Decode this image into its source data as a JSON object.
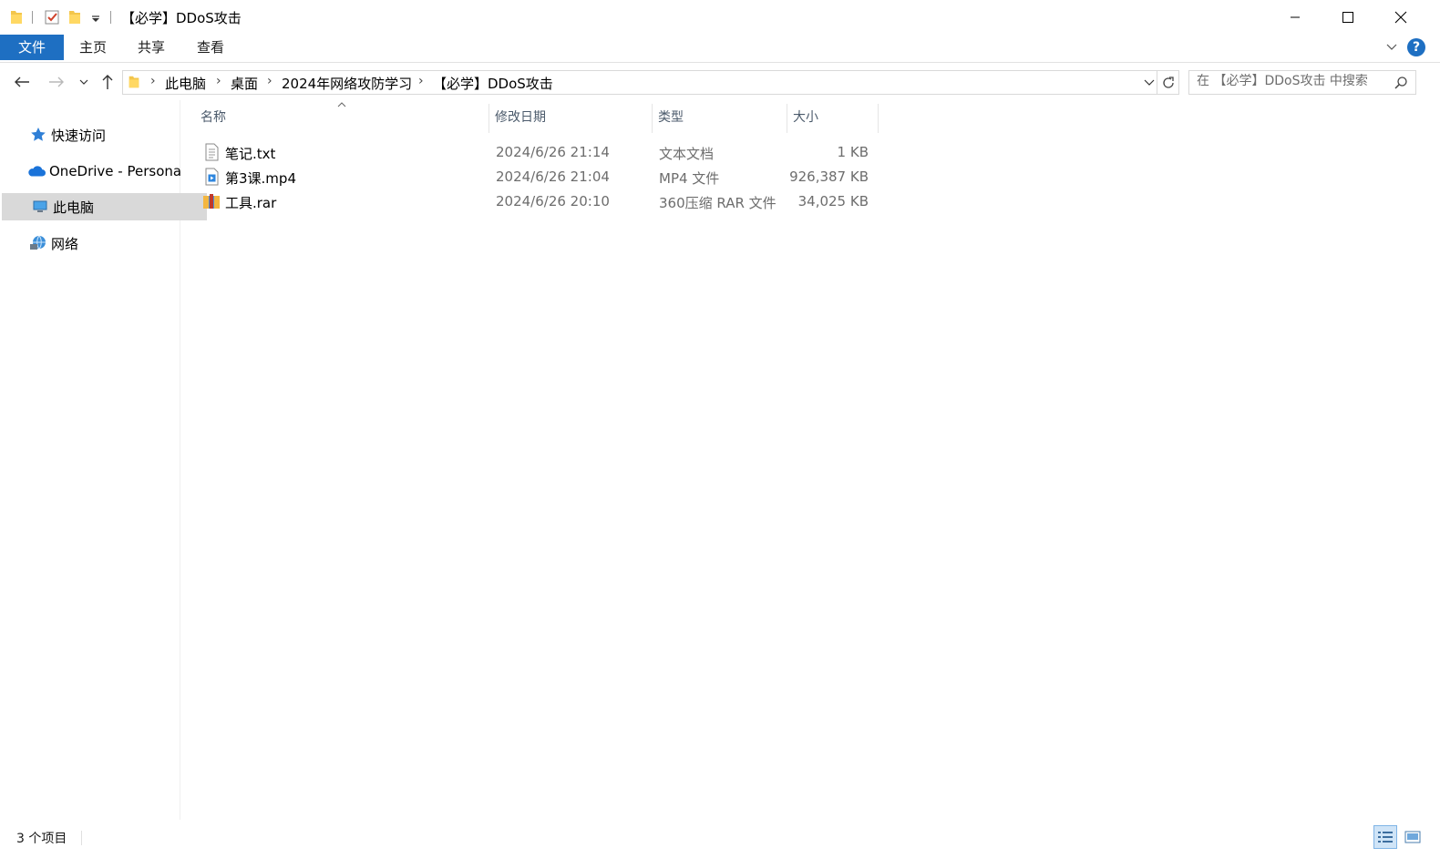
{
  "window": {
    "title": "【必学】DDoS攻击",
    "controls": {
      "minimize": "minimize-icon",
      "maximize": "maximize-icon",
      "close": "close-icon"
    }
  },
  "quick_access_toolbar": [
    "folder-icon",
    "properties-check-icon",
    "new-folder-icon",
    "dropdown-arrow-icon"
  ],
  "ribbon": {
    "tabs": [
      "文件",
      "主页",
      "共享",
      "查看"
    ],
    "active_tab": "文件",
    "accent_color": "#1e6fc2"
  },
  "address": {
    "breadcrumbs": [
      "此电脑",
      "桌面",
      "2024年网络攻防学习",
      "【必学】DDoS攻击"
    ],
    "search_placeholder": "在 【必学】DDoS攻击 中搜索"
  },
  "sidebar": {
    "items": [
      {
        "label": "快速访问",
        "icon": "star-icon",
        "selected": false
      },
      {
        "label": "OneDrive - Persona",
        "icon": "cloud-icon",
        "selected": false
      },
      {
        "label": "此电脑",
        "icon": "computer-icon",
        "selected": true
      },
      {
        "label": "网络",
        "icon": "network-icon",
        "selected": false
      }
    ]
  },
  "file_list": {
    "columns": [
      "名称",
      "修改日期",
      "类型",
      "大小"
    ],
    "sorted_by": "名称",
    "rows": [
      {
        "name": "笔记.txt",
        "date": "2024/6/26 21:14",
        "type": "文本文档",
        "size": "1 KB",
        "icon": "text-file-icon"
      },
      {
        "name": "第3课.mp4",
        "date": "2024/6/26 21:04",
        "type": "MP4 文件",
        "size": "926,387 KB",
        "icon": "video-file-icon"
      },
      {
        "name": "工具.rar",
        "date": "2024/6/26 20:10",
        "type": "360压缩 RAR 文件",
        "size": "34,025 KB",
        "icon": "archive-file-icon"
      }
    ]
  },
  "status": {
    "item_count": "3 个项目",
    "active_view": "details"
  }
}
